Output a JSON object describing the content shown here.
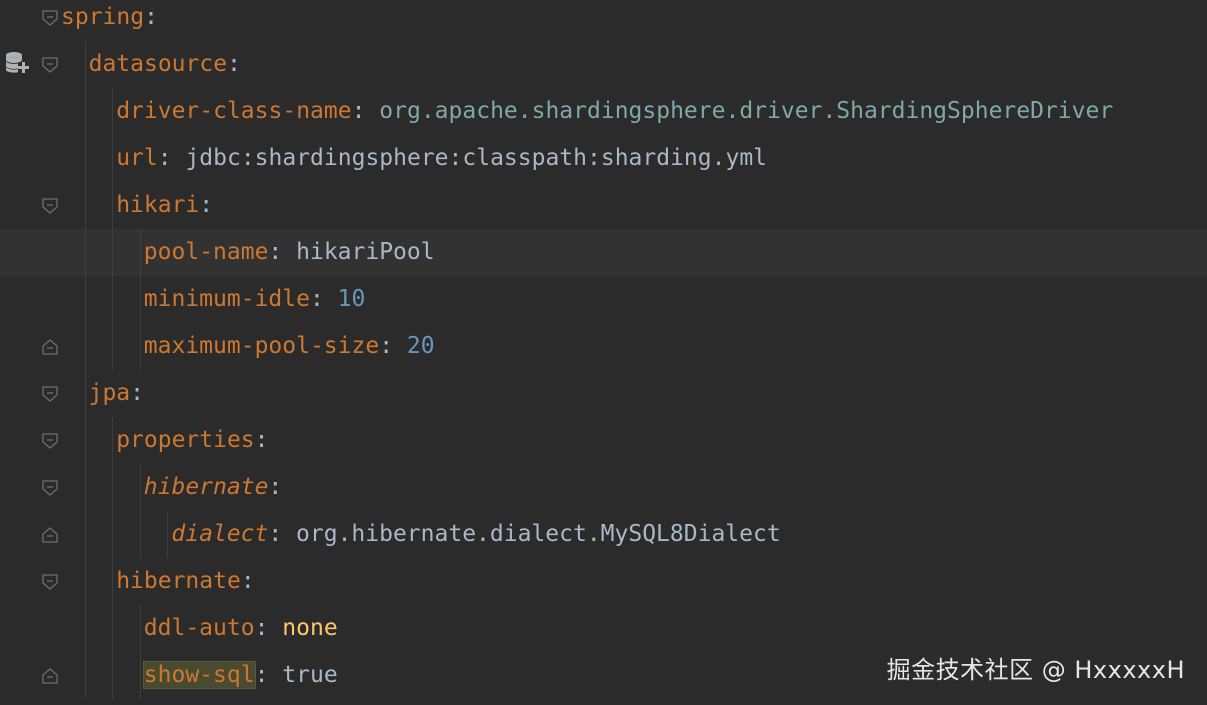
{
  "editor": {
    "language": "yaml",
    "lines": [
      {
        "indent": 0,
        "key": "spring",
        "sep": ":",
        "value": "",
        "value_type": "",
        "fold": "open",
        "italic": false
      },
      {
        "indent": 1,
        "key": "datasource",
        "sep": ":",
        "value": "",
        "value_type": "",
        "fold": "open",
        "italic": false
      },
      {
        "indent": 2,
        "key": "driver-class-name",
        "sep": ": ",
        "value": "org.apache.shardingsphere.driver.ShardingSphereDriver",
        "value_type": "class",
        "fold": "",
        "italic": false
      },
      {
        "indent": 2,
        "key": "url",
        "sep": ": ",
        "value": "jdbc:shardingsphere:classpath:sharding.yml",
        "value_type": "plain",
        "fold": "",
        "italic": false
      },
      {
        "indent": 2,
        "key": "hikari",
        "sep": ":",
        "value": "",
        "value_type": "",
        "fold": "open",
        "italic": false
      },
      {
        "indent": 3,
        "key": "pool-name",
        "sep": ": ",
        "value": "hikariPool",
        "value_type": "plain",
        "fold": "",
        "italic": false,
        "current": true
      },
      {
        "indent": 3,
        "key": "minimum-idle",
        "sep": ": ",
        "value": "10",
        "value_type": "number",
        "fold": "",
        "italic": false
      },
      {
        "indent": 3,
        "key": "maximum-pool-size",
        "sep": ": ",
        "value": "20",
        "value_type": "number",
        "fold": "end",
        "italic": false
      },
      {
        "indent": 1,
        "key": "jpa",
        "sep": ":",
        "value": "",
        "value_type": "",
        "fold": "open",
        "italic": false
      },
      {
        "indent": 2,
        "key": "properties",
        "sep": ":",
        "value": "",
        "value_type": "",
        "fold": "open",
        "italic": false
      },
      {
        "indent": 3,
        "key": "hibernate",
        "sep": ":",
        "value": "",
        "value_type": "",
        "fold": "open",
        "italic": true
      },
      {
        "indent": 4,
        "key": "dialect",
        "sep": ": ",
        "value": "org.hibernate.dialect.MySQL8Dialect",
        "value_type": "plain",
        "fold": "end",
        "italic": true
      },
      {
        "indent": 2,
        "key": "hibernate",
        "sep": ":",
        "value": "",
        "value_type": "",
        "fold": "open",
        "italic": false
      },
      {
        "indent": 3,
        "key": "ddl-auto",
        "sep": ": ",
        "value": "none",
        "value_type": "keyword",
        "fold": "",
        "italic": false
      },
      {
        "indent": 3,
        "key": "show-sql",
        "sep": ": ",
        "value": "true",
        "value_type": "plain",
        "fold": "end",
        "italic": false,
        "highlight_key": true
      }
    ]
  },
  "gutter": {
    "icon": "database-add-icon"
  },
  "watermark": "掘金技术社区 @ HxxxxxH",
  "colors": {
    "background": "#2b2b2b",
    "key": "#cc7832",
    "value": "#a9b7c6",
    "number": "#6897bb",
    "keyword": "#ffc66d",
    "class_value": "#7fa8a8"
  }
}
